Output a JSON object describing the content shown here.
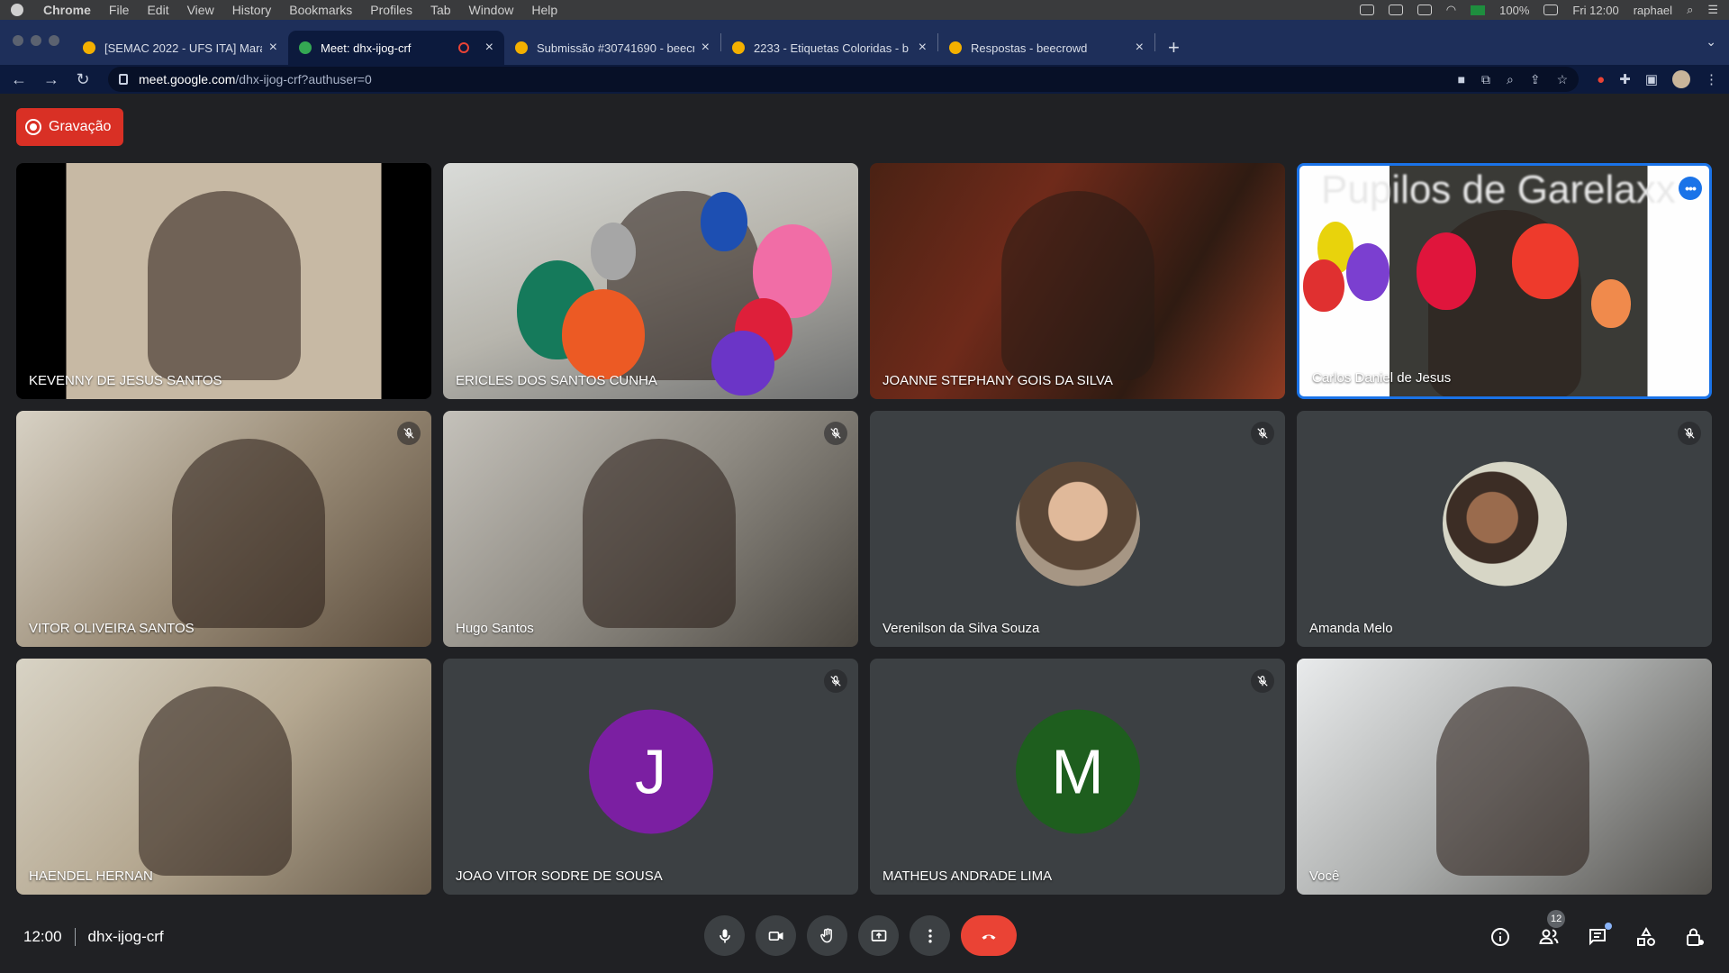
{
  "menubar": {
    "app": "Chrome",
    "items": [
      "File",
      "Edit",
      "View",
      "History",
      "Bookmarks",
      "Profiles",
      "Tab",
      "Window",
      "Help"
    ],
    "battery": "100%",
    "clock": "Fri 12:00",
    "user": "raphael"
  },
  "tabs": [
    {
      "title": "[SEMAC 2022 - UFS ITA] Mara"
    },
    {
      "title": "Meet: dhx-ijog-crf"
    },
    {
      "title": "Submissão #30741690 - beecr"
    },
    {
      "title": "2233 - Etiquetas Coloridas - b"
    },
    {
      "title": "Respostas - beecrowd"
    }
  ],
  "omnibox": {
    "host": "meet.google.com",
    "path": "/dhx-ijog-crf?authuser=0"
  },
  "recording": {
    "label": "Gravação"
  },
  "tile_overlay_title": "Pupilos de Garelaxx",
  "participants": [
    {
      "name": "KEVENNY DE JESUS SANTOS"
    },
    {
      "name": "ERICLES DOS SANTOS CUNHA"
    },
    {
      "name": "JOANNE STEPHANY GOIS DA SILVA"
    },
    {
      "name": "Carlos Daniel de Jesus"
    },
    {
      "name": "VITOR OLIVEIRA SANTOS"
    },
    {
      "name": "Hugo Santos"
    },
    {
      "name": "Verenilson da Silva Souza"
    },
    {
      "name": "Amanda Melo"
    },
    {
      "name": "HAENDEL HERNAN"
    },
    {
      "name": "JOAO VITOR SODRE DE SOUSA",
      "initial": "J",
      "color": "#7b1fa2"
    },
    {
      "name": "MATHEUS ANDRADE LIMA",
      "initial": "M",
      "color": "#1e5e1e"
    },
    {
      "name": "Você"
    }
  ],
  "bottom": {
    "time": "12:00",
    "meeting_code": "dhx-ijog-crf",
    "people_count": "12"
  },
  "colors": {
    "accent": "#1a73e8",
    "hangup": "#ea4335",
    "recording": "#d93025"
  }
}
